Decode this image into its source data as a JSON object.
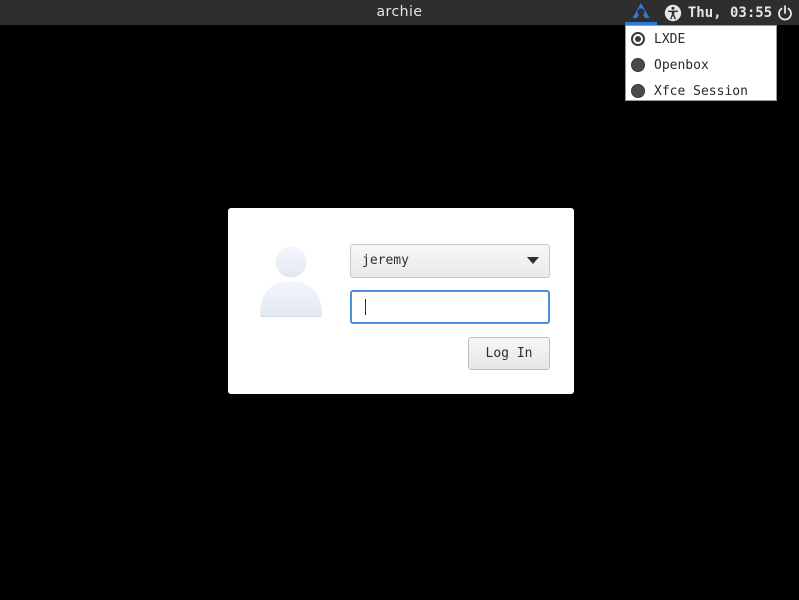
{
  "panel": {
    "hostname": "archie",
    "clock": "Thu, 03:55",
    "icons": {
      "session": "session-icon",
      "accessibility": "accessibility-icon",
      "power": "power-icon"
    }
  },
  "session_menu": {
    "items": [
      {
        "label": "LXDE",
        "selected": true
      },
      {
        "label": "Openbox",
        "selected": false
      },
      {
        "label": "Xfce Session",
        "selected": false
      }
    ]
  },
  "login": {
    "user": "jeremy",
    "password_value": "",
    "login_label": "Log In"
  },
  "colors": {
    "accent": "#2d7bd6",
    "focus": "#4a90d9",
    "panel_bg": "#2e2e2e",
    "background": "#000000"
  }
}
